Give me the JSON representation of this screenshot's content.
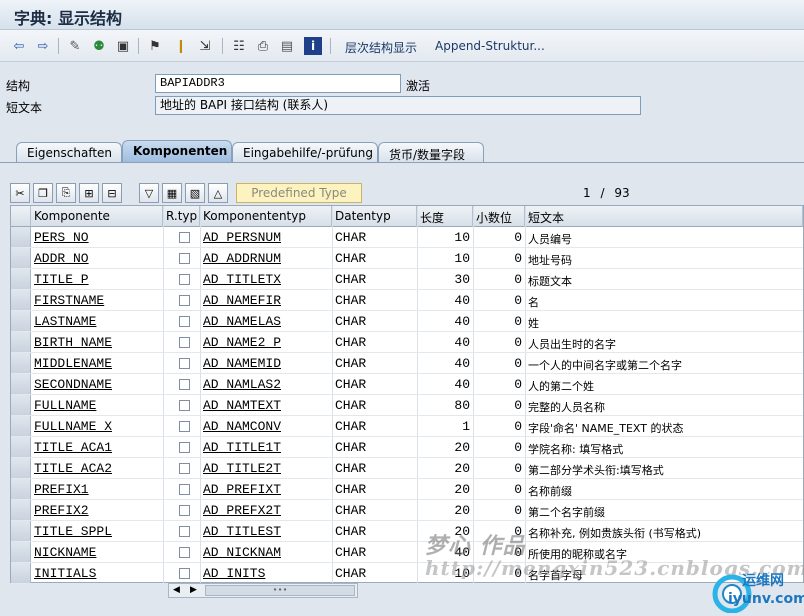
{
  "window": {
    "title": "字典: 显示结构"
  },
  "toolbar": {
    "hierarchy_label": "层次结构显示",
    "append_label": "Append-Struktur..."
  },
  "form": {
    "struct_label": "结构",
    "struct_value": "BAPIADDR3",
    "status": "激活",
    "short_text_label": "短文本",
    "short_text_value": "地址的 BAPI 接口结构 (联系人)"
  },
  "tabs": [
    {
      "label": "Eigenschaften"
    },
    {
      "label": "Komponenten"
    },
    {
      "label": "Eingabehilfe/-prüfung"
    },
    {
      "label": "货币/数量字段"
    }
  ],
  "table_toolbar": {
    "predefined_label": "Predefined Type",
    "page_current": "1",
    "page_sep": "/",
    "page_total": "93"
  },
  "table": {
    "columns": [
      "Komponente",
      "R.typ",
      "Komponententyp",
      "Datentyp",
      "长度",
      "小数位",
      "短文本"
    ],
    "rows": [
      {
        "comp": "PERS_NO",
        "ctype": "AD_PERSNUM",
        "dtype": "CHAR",
        "len": "10",
        "dec": "0",
        "desc": "人员编号"
      },
      {
        "comp": "ADDR_NO",
        "ctype": "AD_ADDRNUM",
        "dtype": "CHAR",
        "len": "10",
        "dec": "0",
        "desc": "地址号码"
      },
      {
        "comp": "TITLE_P",
        "ctype": "AD_TITLETX",
        "dtype": "CHAR",
        "len": "30",
        "dec": "0",
        "desc": "标题文本"
      },
      {
        "comp": "FIRSTNAME",
        "ctype": "AD_NAMEFIR",
        "dtype": "CHAR",
        "len": "40",
        "dec": "0",
        "desc": "名"
      },
      {
        "comp": "LASTNAME",
        "ctype": "AD_NAMELAS",
        "dtype": "CHAR",
        "len": "40",
        "dec": "0",
        "desc": "姓"
      },
      {
        "comp": "BIRTH_NAME",
        "ctype": "AD_NAME2_P",
        "dtype": "CHAR",
        "len": "40",
        "dec": "0",
        "desc": "人员出生时的名字"
      },
      {
        "comp": "MIDDLENAME",
        "ctype": "AD_NAMEMID",
        "dtype": "CHAR",
        "len": "40",
        "dec": "0",
        "desc": "一个人的中间名字或第二个名字"
      },
      {
        "comp": "SECONDNAME",
        "ctype": "AD_NAMLAS2",
        "dtype": "CHAR",
        "len": "40",
        "dec": "0",
        "desc": "人的第二个姓"
      },
      {
        "comp": "FULLNAME",
        "ctype": "AD_NAMTEXT",
        "dtype": "CHAR",
        "len": "80",
        "dec": "0",
        "desc": "完整的人员名称"
      },
      {
        "comp": "FULLNAME_X",
        "ctype": "AD_NAMCONV",
        "dtype": "CHAR",
        "len": "1",
        "dec": "0",
        "desc": "字段'命名' NAME_TEXT 的状态"
      },
      {
        "comp": "TITLE_ACA1",
        "ctype": "AD_TITLE1T",
        "dtype": "CHAR",
        "len": "20",
        "dec": "0",
        "desc": "学院名称: 填写格式"
      },
      {
        "comp": "TITLE_ACA2",
        "ctype": "AD_TITLE2T",
        "dtype": "CHAR",
        "len": "20",
        "dec": "0",
        "desc": "第二部分学术头衔:填写格式"
      },
      {
        "comp": "PREFIX1",
        "ctype": "AD_PREFIXT",
        "dtype": "CHAR",
        "len": "20",
        "dec": "0",
        "desc": "名称前缀"
      },
      {
        "comp": "PREFIX2",
        "ctype": "AD_PREFX2T",
        "dtype": "CHAR",
        "len": "20",
        "dec": "0",
        "desc": "第二个名字前缀"
      },
      {
        "comp": "TITLE_SPPL",
        "ctype": "AD_TITLEST",
        "dtype": "CHAR",
        "len": "20",
        "dec": "0",
        "desc": "名称补充, 例如贵族头衔 (书写格式)"
      },
      {
        "comp": "NICKNAME",
        "ctype": "AD_NICKNAM",
        "dtype": "CHAR",
        "len": "40",
        "dec": "0",
        "desc": "所使用的昵称或名字"
      },
      {
        "comp": "INITIALS",
        "ctype": "AD_INITS",
        "dtype": "CHAR",
        "len": "10",
        "dec": "0",
        "desc": "名字首字母"
      }
    ]
  },
  "watermark": {
    "line1": "梦心 作品",
    "line2": "http://mengxin523.cnblogs.com"
  },
  "logo": {
    "text1": "运维网",
    "text2": "iyunv.com"
  },
  "colors": {
    "accent": "#1b3a66",
    "tab_active": "#9fbde0",
    "predefined_bg": "#fdf3c0"
  }
}
